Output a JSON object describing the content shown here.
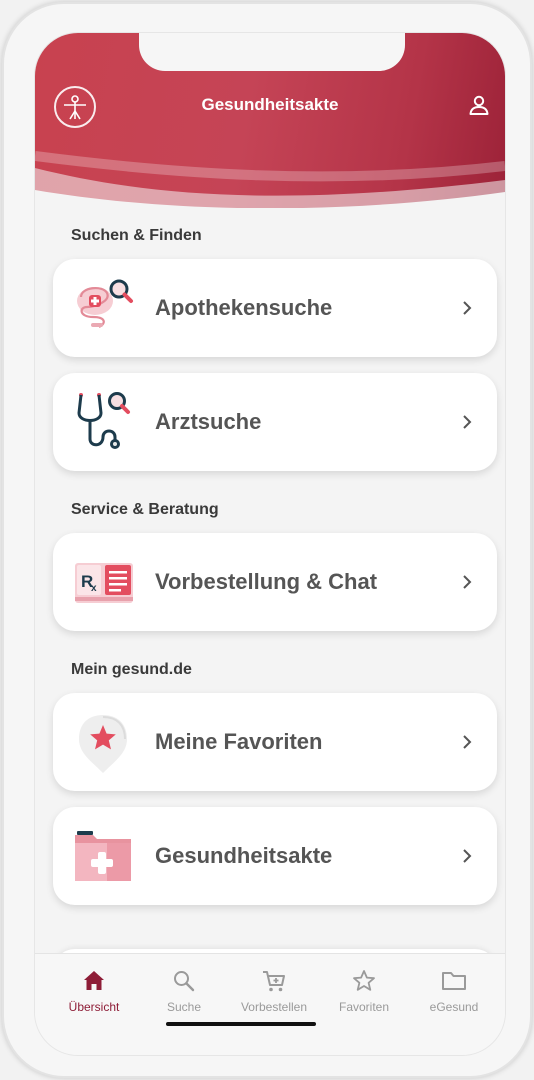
{
  "header": {
    "title": "Gesundheitsakte",
    "logo_icon": "vitruvian-man-icon",
    "profile_icon": "user-icon",
    "colors": {
      "primary": "#c8424f",
      "dark": "#9c2238"
    }
  },
  "sections": [
    {
      "label": "Suchen & Finden"
    },
    {
      "label": "Service & Beratung"
    },
    {
      "label": "Mein gesund.de"
    }
  ],
  "cards": [
    {
      "label": "Apothekensuche",
      "icon": "pharmacy-search-icon"
    },
    {
      "label": "Arztsuche",
      "icon": "stethoscope-search-icon"
    },
    {
      "label": "Vorbestellung & Chat",
      "icon": "prescription-icon"
    },
    {
      "label": "Meine Favoriten",
      "icon": "star-badge-icon"
    },
    {
      "label": "Gesundheitsakte",
      "icon": "health-folder-icon"
    }
  ],
  "bottom_nav": {
    "items": [
      {
        "label": "Übersicht",
        "icon": "home-icon",
        "active": true
      },
      {
        "label": "Suche",
        "icon": "search-icon",
        "active": false
      },
      {
        "label": "Vorbestellen",
        "icon": "cart-icon",
        "active": false
      },
      {
        "label": "Favoriten",
        "icon": "star-icon",
        "active": false
      },
      {
        "label": "eGesund",
        "icon": "folder-icon",
        "active": false
      }
    ],
    "active_color": "#8e1d37",
    "inactive_color": "#9a9a9a"
  }
}
